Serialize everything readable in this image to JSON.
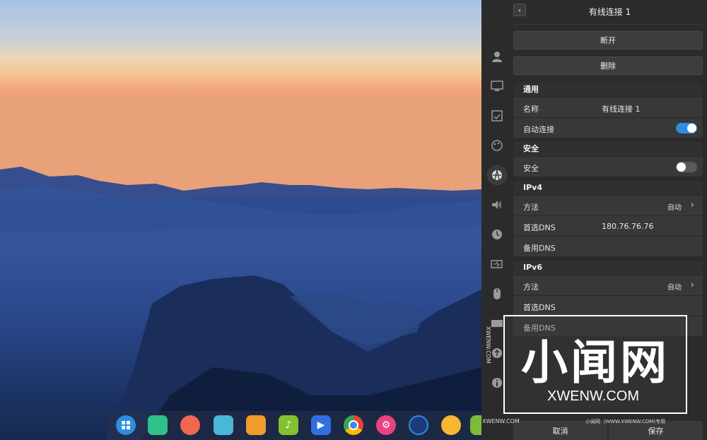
{
  "panel": {
    "title": "有线连接 1",
    "back_glyph": "‹",
    "disconnect_label": "断开",
    "delete_label": "删除",
    "general": {
      "header": "通用",
      "name_label": "名称",
      "name_value": "有线连接 1",
      "auto_connect_label": "自动连接",
      "auto_connect_on": true
    },
    "security": {
      "header": "安全",
      "security_label": "安全",
      "security_on": false
    },
    "ipv4": {
      "header": "IPv4",
      "method_label": "方法",
      "method_value": "自动",
      "primary_dns_label": "首选DNS",
      "primary_dns_value": "180.76.76.76",
      "secondary_dns_label": "备用DNS"
    },
    "ipv6": {
      "header": "IPv6",
      "method_label": "方法",
      "method_value": "自动",
      "primary_dns_label": "首选DNS",
      "secondary_dns_label": "备用DNS"
    },
    "cancel_label": "取消",
    "save_label": "保存"
  },
  "side_nav": [
    "user-icon",
    "display-icon",
    "calendar-icon",
    "palette-icon",
    "network-icon",
    "sound-icon",
    "clock-icon",
    "power-icon",
    "mouse-icon",
    "keyboard-icon",
    "update-icon",
    "info-icon"
  ],
  "dock_apps": [
    "launcher-icon",
    "file-manager-icon",
    "presentation-icon",
    "archive-icon",
    "app-store-icon",
    "music-icon",
    "video-icon",
    "chrome-icon",
    "settings-icon",
    "screen-recorder-icon",
    "photos-icon",
    "more-icon"
  ],
  "watermark": {
    "title": "小闻网",
    "domain": "XWENW.COM",
    "side_text": "XWENW.COM",
    "bottom_left": "XWENW.COM",
    "bottom_right": "小闻网（WWW.XWENW.COM)专用"
  },
  "colors": {
    "panel_bg": "#2b2b2b",
    "row_bg": "#383838",
    "accent": "#2d8de0"
  }
}
